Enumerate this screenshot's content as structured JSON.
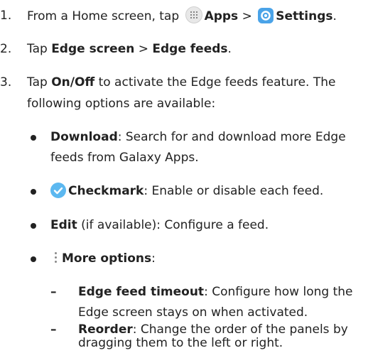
{
  "steps": [
    {
      "num": "1.",
      "pre": "From a Home screen, tap",
      "apps": "Apps",
      "sep": " > ",
      "settings": "Settings",
      "post": "."
    },
    {
      "num": "2.",
      "pre": "Tap ",
      "a": "Edge screen",
      "sep": " > ",
      "b": "Edge feeds",
      "post": "."
    },
    {
      "num": "3.",
      "pre": "Tap ",
      "a": "On/Off",
      "rest": " to activate the Edge feeds feature. The",
      "line2": "following options are available:"
    }
  ],
  "bullets": [
    {
      "label": "Download",
      "text": ": Search for and download more Edge",
      "line2": "feeds from Galaxy Apps."
    },
    {
      "label": "Checkmark",
      "text": ": Enable or disable each feed."
    },
    {
      "label": "Edit",
      "text": " (if available): Configure a feed."
    },
    {
      "label": "More options",
      "text": ":"
    }
  ],
  "subbullets": [
    {
      "dash": "–",
      "label": "Edge feed timeout",
      "text": ": Configure how long the",
      "line2": "Edge screen stays on when activated."
    },
    {
      "dash": "–",
      "label": "Reorder",
      "text": ": Change the order of the panels by",
      "line2": "dragging them to the left or right."
    }
  ],
  "icons": {
    "apps": "apps-grid-icon",
    "settings": "settings-gear-icon",
    "checkmark": "checkmark-icon",
    "more": "more-options-icon"
  },
  "colors": {
    "text": "#222222",
    "accent": "#4aa3e8",
    "check": "#5cb8f0"
  }
}
